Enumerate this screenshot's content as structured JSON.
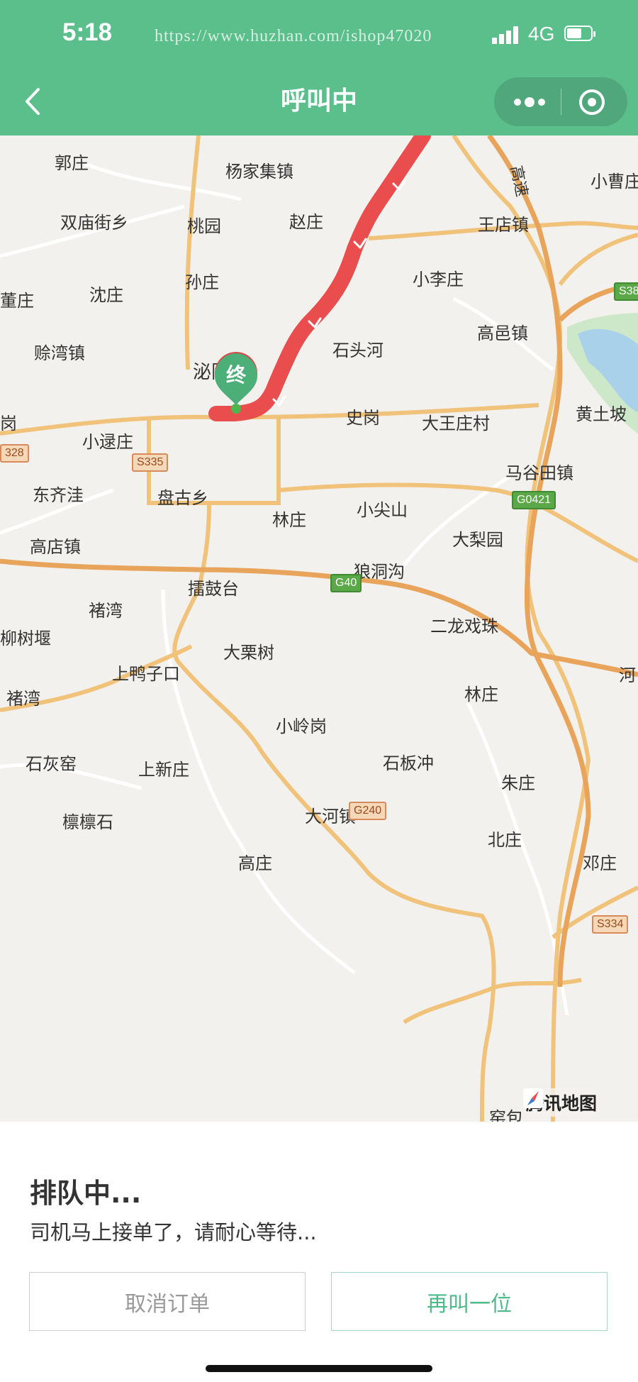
{
  "status_bar": {
    "time": "5:18",
    "watermark": "https://www.huzhan.com/ishop47020",
    "network": "4G"
  },
  "nav": {
    "title": "呼叫中",
    "icons": {
      "back": "chevron-left-icon",
      "more": "more-dots-icon",
      "close": "target-circle-icon"
    }
  },
  "map": {
    "end_marker": "终",
    "brand": "腾讯地图",
    "route_color": "#e94d4d",
    "places": [
      "郭庄",
      "杨家集镇",
      "小曹庄",
      "双庙街乡",
      "桃园",
      "赵庄",
      "王店镇",
      "孙庄",
      "小李庄",
      "沈庄",
      "董庄",
      "高邑镇",
      "赊湾镇",
      "石头河",
      "泌阳县",
      "史岗",
      "大王庄村",
      "黄土坡",
      "岗",
      "小逯庄",
      "马谷田镇",
      "东齐洼",
      "盘古乡",
      "林庄",
      "小尖山",
      "大梨园",
      "高店镇",
      "擂鼓台",
      "狼洞沟",
      "褚湾",
      "二龙戏珠",
      "柳树堰",
      "大栗树",
      "河",
      "上鸭子口",
      "林庄",
      "褚湾",
      "小岭岗",
      "石灰窑",
      "上新庄",
      "石板冲",
      "朱庄",
      "檩檩石",
      "大河镇",
      "北庄",
      "高庄",
      "邓庄",
      "窑包"
    ],
    "road_labels": [
      "S335",
      "328",
      "G0421",
      "G40",
      "G240",
      "S334",
      "S38"
    ],
    "highway_label": "高速"
  },
  "panel": {
    "status_title": "排队中...",
    "status_desc": "司机马上接单了，请耐心等待...",
    "cancel_label": "取消订单",
    "recall_label": "再叫一位"
  },
  "colors": {
    "brand_green": "#5bbf8c",
    "accent_text": "#4fbb8a"
  }
}
